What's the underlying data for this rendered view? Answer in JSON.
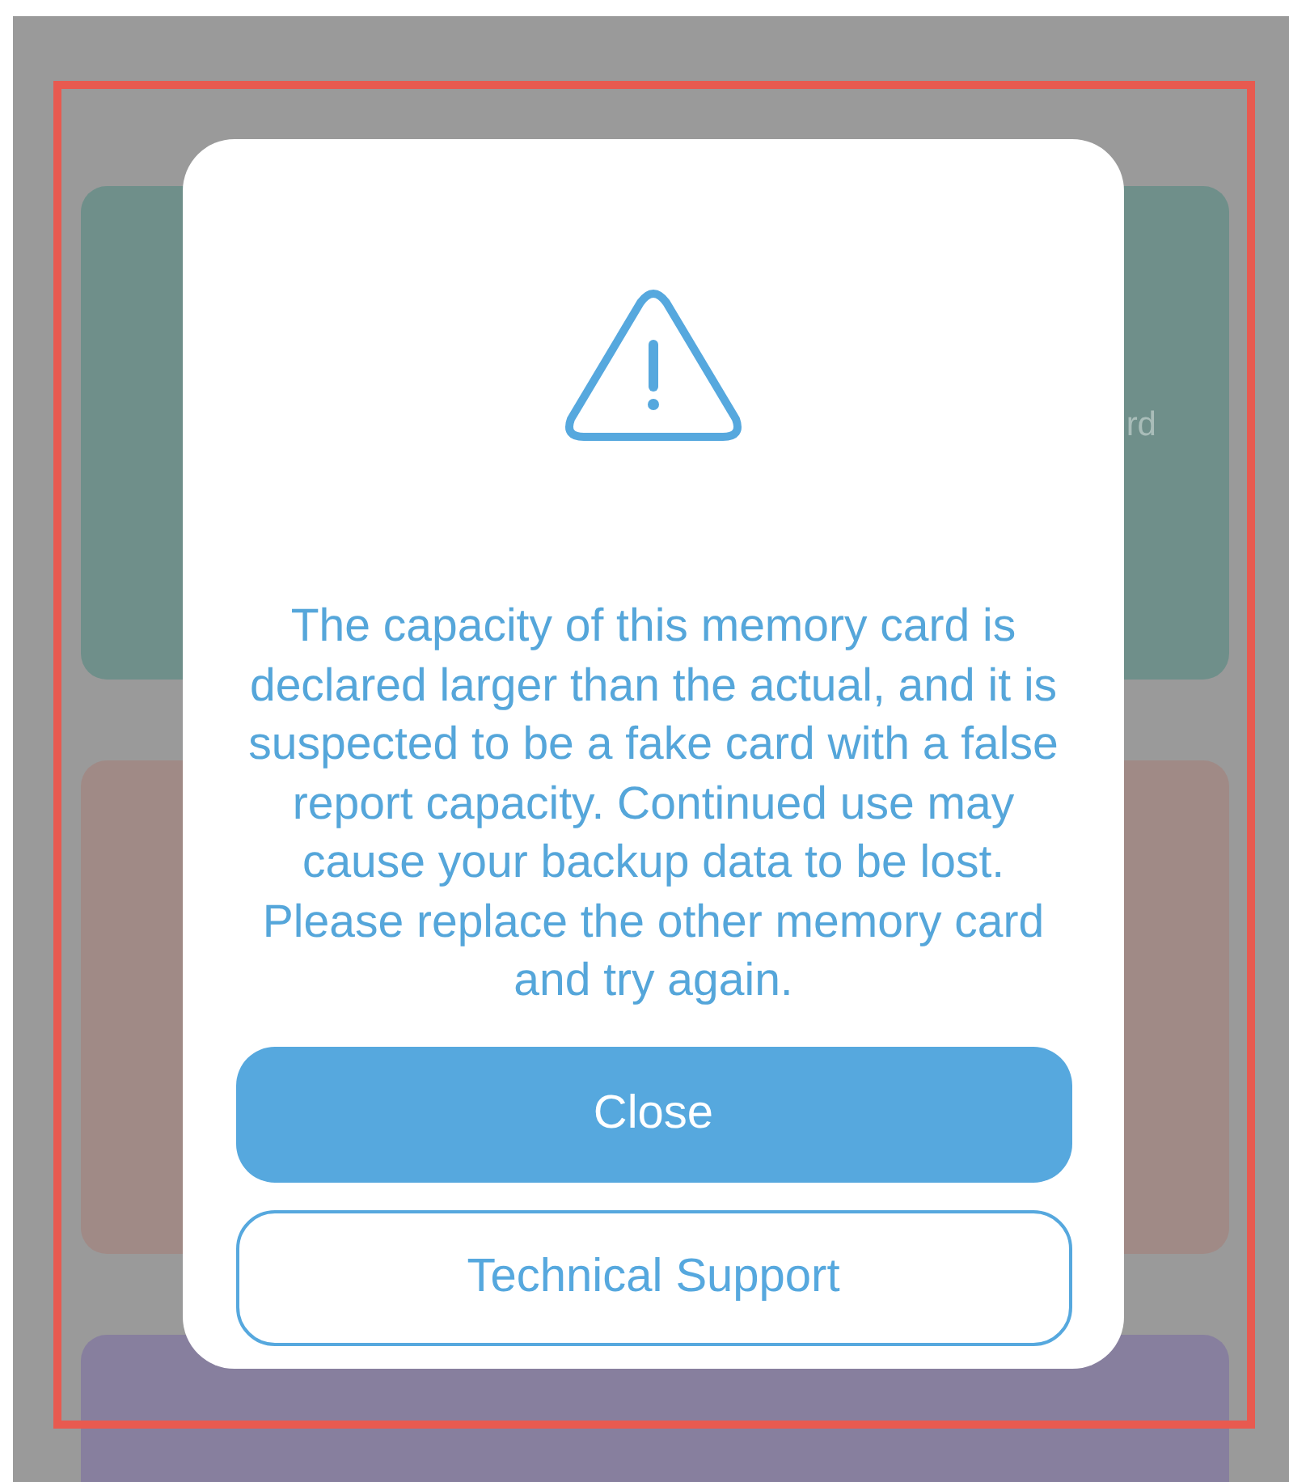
{
  "background_cards": [
    {
      "color": "#6f8f8a",
      "label": "rd"
    },
    {
      "color": "#a08a86"
    },
    {
      "color": "#877f9e"
    }
  ],
  "dialog": {
    "message": "The capacity of this memory card is declared larger than the actual, and it is suspected to be a fake card with a false report capacity. Continued use may cause your backup data to be lost. Please replace the other memory card and try again.",
    "buttons": [
      {
        "label": "Close",
        "kind": "primary"
      },
      {
        "label": "Technical Support",
        "kind": "outline"
      }
    ]
  }
}
